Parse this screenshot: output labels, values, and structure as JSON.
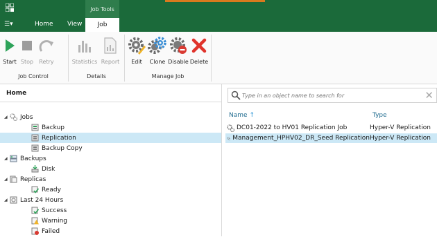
{
  "ribbon_tabs": {
    "menu": "☰▾",
    "home": "Home",
    "view": "View",
    "job": "Job",
    "context_title": "Job Tools"
  },
  "ribbon": {
    "job_control": {
      "label": "Job Control",
      "start": "Start",
      "stop": "Stop",
      "retry": "Retry"
    },
    "details": {
      "label": "Details",
      "statistics": "Statistics",
      "report": "Report"
    },
    "manage_job": {
      "label": "Manage Job",
      "edit": "Edit",
      "clone": "Clone",
      "disable": "Disable",
      "delete": "Delete"
    }
  },
  "left_panel": {
    "title": "Home",
    "tree": {
      "jobs": "Jobs",
      "backup": "Backup",
      "replication": "Replication",
      "backup_copy": "Backup Copy",
      "backups": "Backups",
      "disk": "Disk",
      "replicas": "Replicas",
      "ready": "Ready",
      "last24": "Last 24 Hours",
      "success": "Success",
      "warning": "Warning",
      "failed": "Failed"
    }
  },
  "right_panel": {
    "search_placeholder": "Type in an object name to search for",
    "columns": {
      "name": "Name",
      "sort_arrow": "↑",
      "type": "Type"
    },
    "rows": [
      {
        "name": "DC01-2022 to HV01 Replication Job",
        "type": "Hyper-V Replication"
      },
      {
        "name": "Management_HPHV02_DR_Seed Replication",
        "type": "Hyper-V Replication"
      }
    ]
  },
  "colors": {
    "brand_green": "#1b6a3a",
    "selection": "#cce8f6",
    "accent_orange": "#d97a1e"
  }
}
